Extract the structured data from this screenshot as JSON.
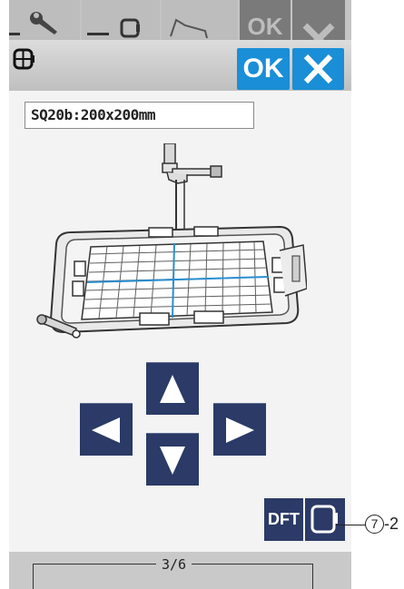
{
  "top_tabs": {
    "ok_label": "OK",
    "icons": [
      "wrench-icon",
      "hoop-icon",
      "stitch-icon",
      "close-icon"
    ]
  },
  "header": {
    "icon": "hoop-icon",
    "ok_label": "OK",
    "cancel_icon": "close-icon"
  },
  "hoop": {
    "name": "SQ20b:200x200mm"
  },
  "jog_keys": [
    "arrow-up",
    "arrow-left",
    "arrow-right",
    "arrow-down"
  ],
  "buttons": {
    "default_label": "DFT",
    "hoop_icon": "hoop-icon"
  },
  "page": {
    "indicator": "3/6"
  },
  "callout": {
    "number": "7",
    "suffix": "-2"
  },
  "colors": {
    "accent_blue": "#1a8ed6",
    "key_navy": "#2b3a66",
    "screen_bg": "#f3f3f3"
  }
}
